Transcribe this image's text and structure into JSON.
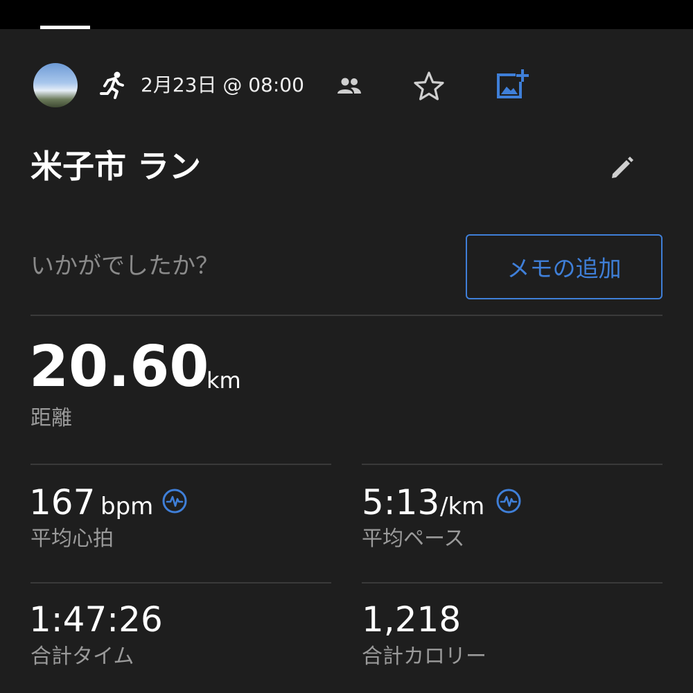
{
  "activity": {
    "date": "2月23日 @ 08:00",
    "title": "米子市 ラン",
    "prompt": "いかがでしたか？",
    "memo_button_label": "メモの追加"
  },
  "distance": {
    "value": "20.60",
    "unit": "km",
    "label": "距離"
  },
  "stats": {
    "heart_rate": {
      "value": "167",
      "unit": "bpm",
      "label": "平均心拍"
    },
    "pace": {
      "value": "5:13",
      "unit": "/km",
      "label": "平均ペース"
    },
    "total_time": {
      "value": "1:47:26",
      "label": "合計タイム"
    },
    "calories": {
      "value": "1,218",
      "label": "合計カロリー"
    }
  },
  "icons": {
    "activity_type": "running-icon",
    "social": "people-icon",
    "favorite": "star-icon",
    "add_photo": "add-photo-icon",
    "edit": "pencil-icon",
    "metric_info": "heart-wave-icon"
  },
  "colors": {
    "background": "#1e1e1e",
    "accent": "#3f7fd8",
    "secondary_text": "#9a9a9a"
  }
}
